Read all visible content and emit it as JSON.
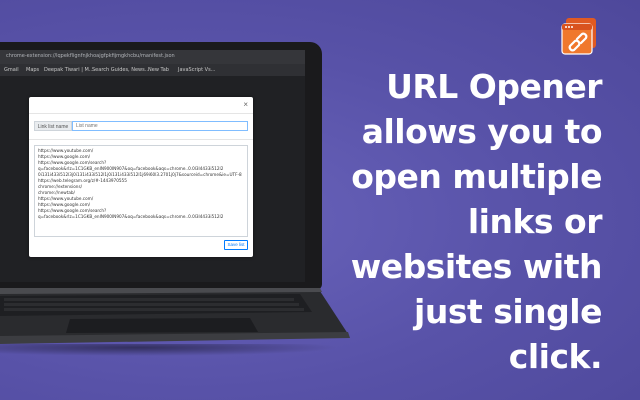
{
  "browser": {
    "url": "chrome-extension://lqpekflignfnjkhoajgfpkfijmgkhcbu/manifest.json",
    "bookmarks": [
      "Gmail",
      "Maps",
      "Deepak Tiwari | M...",
      "Search Guides, News...",
      "New Tab",
      "JavaScript Vs..."
    ]
  },
  "dialog": {
    "close_label": "×",
    "name_label": "Link list name",
    "name_placeholder": "List name",
    "links": [
      "https://www.youtube.com/",
      "https://www.google.com/",
      "https://www.google.com/search?",
      "q=facebook&rlz=1C1GKB_enIN900IN907&oq=facebook&aqs=chrome..0.0l3l4433i512l2",
      "0i131i433i512l3j0i131i433i512l1j0i131i433i512l1j69i60l3.2701j0j7&sourceid=chrome&ie=UTF-8",
      "https://web.telegram.org/z/#-1443970555",
      "chrome://extensions/",
      "chrome://newtab/",
      "https://www.youtube.com/",
      "https://www.google.com/",
      "https://www.google.com/search?",
      "q=facebook&rlz=1C1GKB_enIN900IN907&oq=facebook&aqs=chrome..0.0l3l4433i512l2"
    ],
    "save_label": "Save list"
  },
  "headline": {
    "lines": [
      "URL Opener",
      "allows you to",
      "open multiple",
      "links or",
      "websites with",
      "just single",
      "click."
    ]
  },
  "colors": {
    "background": "#5b55ad",
    "logo_orange": "#f0782d",
    "headline": "#ffffff",
    "save_button": "#007bff"
  },
  "icons": {
    "logo": "browser-window-link-icon"
  }
}
